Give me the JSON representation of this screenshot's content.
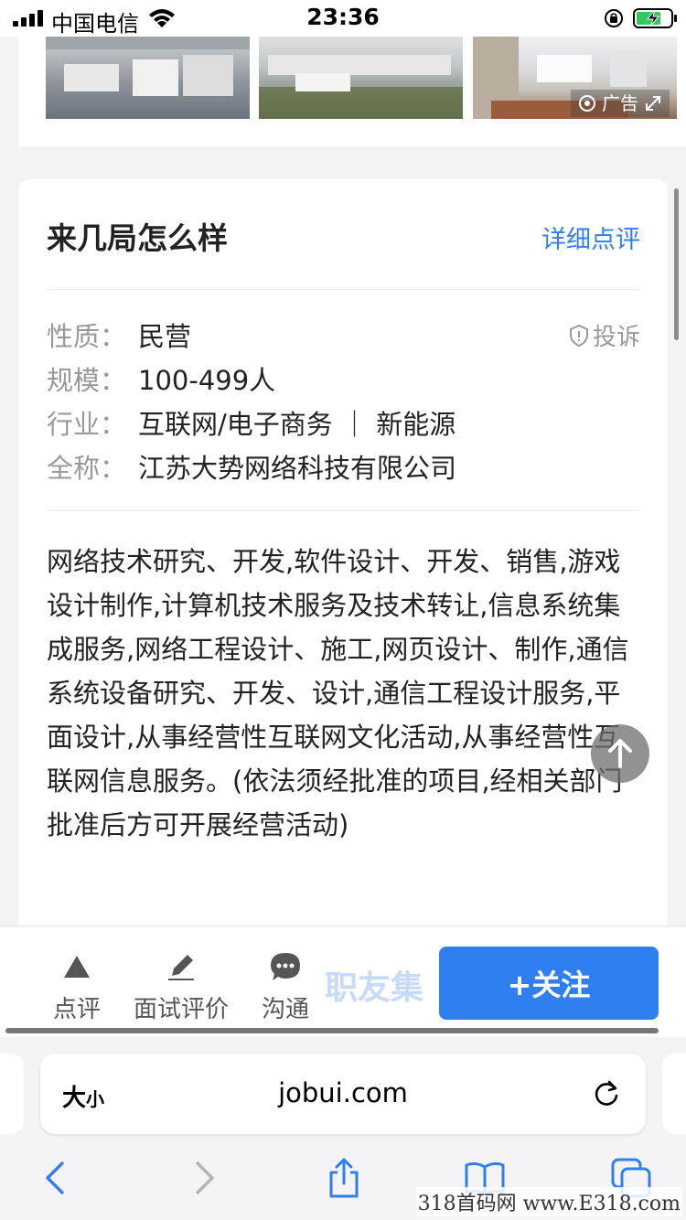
{
  "status_bar": {
    "carrier": "中国电信",
    "time": "23:36"
  },
  "ad": {
    "label": "广告"
  },
  "company_card": {
    "title": "来几局怎么样",
    "detail_link": "详细点评",
    "report": "投诉",
    "info": [
      {
        "key": "性质：",
        "value": "民营"
      },
      {
        "key": "规模：",
        "value": "100-499人"
      },
      {
        "key": "行业：",
        "value": "互联网/电子商务 ｜ 新能源"
      },
      {
        "key": "全称：",
        "value": "江苏大势网络科技有限公司"
      }
    ],
    "description": "网络技术研究、开发,软件设计、开发、销售,游戏设计制作,计算机技术服务及技术转让,信息系统集成服务,网络工程设计、施工,网页设计、制作,通信系统设备研究、开发、设计,通信工程设计服务,平面设计,从事经营性互联网文化活动,从事经营性互联网信息服务。(依法须经批准的项目,经相关部门批准后方可开展经营活动)"
  },
  "action_bar": {
    "review": "点评",
    "interview_review": "面试评价",
    "chat": "沟通",
    "watermark": "职友集",
    "follow": "+关注"
  },
  "browser": {
    "text_size_big": "大",
    "text_size_small": "小",
    "url": "jobui.com"
  },
  "corner_watermark": "318首码网 www.E318.com"
}
